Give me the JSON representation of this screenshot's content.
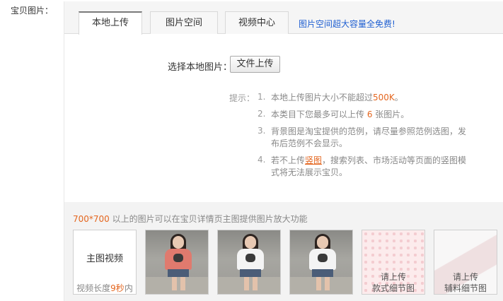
{
  "field_label": "宝贝图片：",
  "tabs": [
    {
      "label": "本地上传",
      "active": true
    },
    {
      "label": "图片空间",
      "active": false
    },
    {
      "label": "视频中心",
      "active": false
    }
  ],
  "tab_promo": "图片空间超大容量全免费!",
  "upload": {
    "label": "选择本地图片：",
    "button": "文件上传"
  },
  "tips": {
    "label": "提示：",
    "items": [
      {
        "num": "1.",
        "before": "本地上传图片大小不能超过",
        "highlight": "500K",
        "after": "。"
      },
      {
        "num": "2.",
        "before": "本类目下您最多可以上传 ",
        "highlight": "6",
        "after": " 张图片。"
      },
      {
        "num": "3.",
        "text": "背景图是淘宝提供的范例，请尽量参照范例选图，发布后范例不会显示。"
      },
      {
        "num": "4.",
        "before": "若不上传",
        "highlight": "竖图",
        "after": "，搜索列表、市场活动等页面的竖图模式将无法展示宝贝。"
      }
    ]
  },
  "gallery": {
    "note_highlight": "700*700",
    "note_rest": " 以上的图片可以在宝贝详情页主图提供图片放大功能",
    "video": {
      "title": "主图视频",
      "sub_before": "视频长度",
      "sub_highlight": "9秒",
      "sub_after": "内"
    },
    "photos": [
      {
        "icon": "product-photo-pink-tshirt",
        "shirt_color": "#e07a6e"
      },
      {
        "icon": "product-photo-white-tshirt",
        "shirt_color": "#f4f4f4"
      },
      {
        "icon": "product-photo-white-tshirt",
        "shirt_color": "#f4f4f4"
      }
    ],
    "placeholders": [
      {
        "line1": "请上传",
        "line2": "款式细节图"
      },
      {
        "line1": "请上传",
        "line2": "辅料细节图"
      }
    ]
  },
  "colors": {
    "accent": "#e4661f",
    "link": "#1f5fd1"
  }
}
